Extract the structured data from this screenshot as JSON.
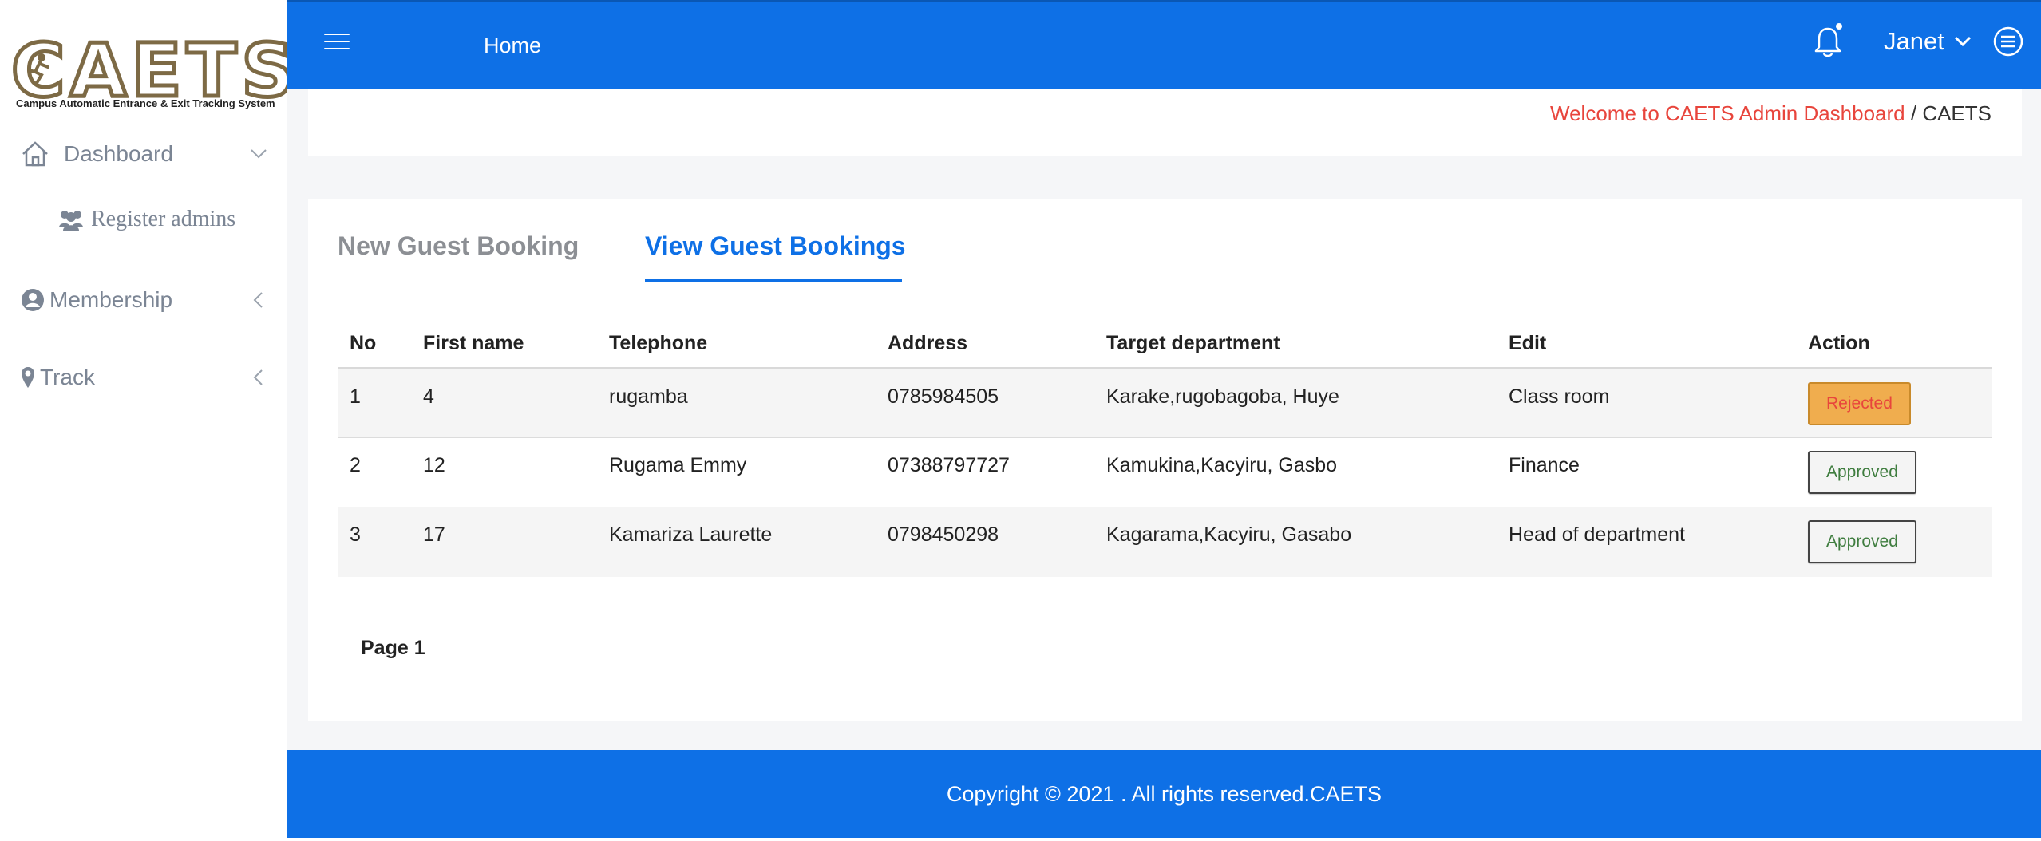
{
  "brand": {
    "logo_text": "CAETS",
    "logo_subtitle": "Campus Automatic Entrance & Exit Tracking System"
  },
  "sidebar": {
    "items": [
      {
        "label": "Dashboard",
        "icon": "home-icon"
      },
      {
        "label": "Register admins",
        "icon": "users-icon"
      },
      {
        "label": "Membership",
        "icon": "user-circle-icon"
      },
      {
        "label": "Track",
        "icon": "map-marker-icon"
      }
    ]
  },
  "header": {
    "home_label": "Home",
    "user_name": "Janet"
  },
  "breadcrumb": {
    "link": "Welcome to CAETS Admin Dashboard",
    "separator": " / ",
    "current": "CAETS"
  },
  "tabs": [
    {
      "label": "New Guest Booking",
      "active": false
    },
    {
      "label": "View Guest Bookings",
      "active": true
    }
  ],
  "table": {
    "columns": [
      "No",
      "First name",
      "Telephone",
      "Address",
      "Target department",
      "Edit",
      "Action"
    ],
    "rows": [
      {
        "no": "1",
        "first_name": "4",
        "telephone": "rugamba",
        "address": "0785984505",
        "target_department": "Karake,rugobagoba, Huye",
        "edit": "Class room",
        "action": "Rejected"
      },
      {
        "no": "2",
        "first_name": "12",
        "telephone": "Rugama Emmy",
        "address": "07388797727",
        "target_department": "Kamukina,Kacyiru, Gasbo",
        "edit": "Finance",
        "action": "Approved"
      },
      {
        "no": "3",
        "first_name": "17",
        "telephone": "Kamariza Laurette",
        "address": "0798450298",
        "target_department": "Kagarama,Kacyiru, Gasabo",
        "edit": "Head of department",
        "action": "Approved"
      }
    ]
  },
  "pagination": {
    "label": "Page 1"
  },
  "footer": {
    "text": "Copyright © 2021 . All rights reserved.CAETS"
  },
  "colors": {
    "primary": "#0e70e6",
    "breadcrumb_link": "#e8453c",
    "rejected_bg": "#f0ad4e",
    "approved_text": "#3f7d3f"
  }
}
